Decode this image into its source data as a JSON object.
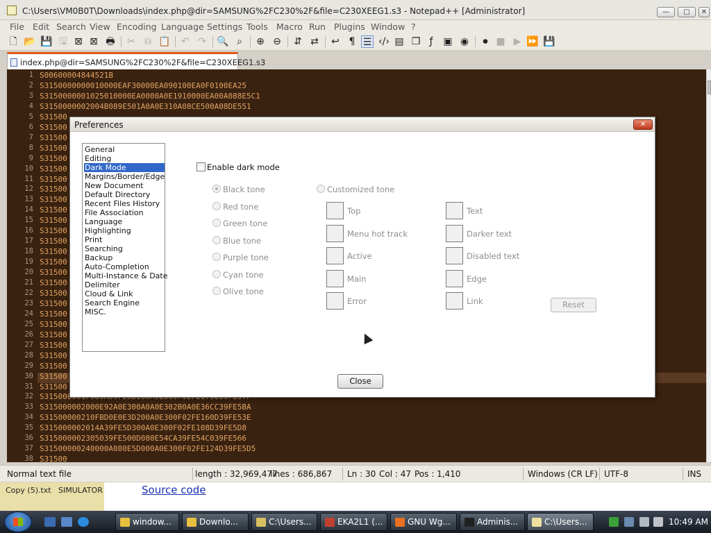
{
  "window": {
    "title": "C:\\Users\\VM0B0T\\Downloads\\index.php@dir=SAMSUNG%2FC230%2F&file=C230XEEG1.s3 - Notepad++ [Administrator]",
    "buttons": {
      "minimize": "—",
      "restore": "□",
      "close": "✕"
    }
  },
  "menu": [
    "File",
    "Edit",
    "Search",
    "View",
    "Encoding",
    "Language",
    "Settings",
    "Tools",
    "Macro",
    "Run",
    "Plugins",
    "Window",
    "?"
  ],
  "tab": {
    "label": "index.php@dir=SAMSUNG%2FC230%2F&file=C230XEEG1.s3"
  },
  "editor": {
    "line_numbers": [
      "1",
      "2",
      "3",
      "4",
      "5",
      "6",
      "7",
      "8",
      "9",
      "10",
      "11",
      "12",
      "13",
      "14",
      "15",
      "16",
      "17",
      "18",
      "19",
      "20",
      "21",
      "22",
      "23",
      "24",
      "25",
      "26",
      "27",
      "28",
      "29",
      "30",
      "31",
      "32",
      "33",
      "34",
      "35",
      "36",
      "37",
      "38"
    ],
    "lines": [
      "S00600004844521B",
      "S3150000000010000EAF30000EA090100EA0F0100EA25",
      "S3150000001025010000EA0000A0E1910000EA00A088E5C1",
      "S3150000002004B089E501A0A0E310A08CE500A08DE551",
      "S31500",
      "S31500",
      "S31500",
      "S31500",
      "S31500",
      "S31500",
      "S31500",
      "S31500",
      "S31500",
      "S31500",
      "S31500",
      "S31500",
      "S31500",
      "S31500",
      "S31500",
      "S31500",
      "S31500",
      "S31500",
      "S31500",
      "S31500",
      "S31500",
      "S31500",
      "S31500",
      "S31500",
      "S31500",
      "S31500",
      "S31500",
      "S315000001F080A39FE5D100A0E300F02FE178839FE57F",
      "S315000002000E92A0E300A0A0E302B0A0E36CC39FE5BA",
      "S31500000210FBD0E0E3D200A0E300F02FE160D39FE53E",
      "S315000002014A39FE5D300A0E300F02FE108D39FE5D8",
      "S315000002305039FE500D080E54CA39FE54C039FE566",
      "S31500000240000A080E5D000A0E300F02FE124D39FE5D5",
      "S31500"
    ]
  },
  "status": {
    "file_type": "Normal text file",
    "length": "length : 32,969,477",
    "lines": "lines : 686,867",
    "ln": "Ln : 30",
    "col": "Col : 47",
    "pos": "Pos : 1,410",
    "eol": "Windows (CR LF)",
    "encoding": "UTF-8",
    "mode": "INS"
  },
  "behind": {
    "item1": "Copy (5).txt",
    "item2": "SIMULATOR",
    "link": "Source code"
  },
  "dialog": {
    "title": "Preferences",
    "categories": [
      "General",
      "Editing",
      "Dark Mode",
      "Margins/Border/Edge",
      "New Document",
      "Default Directory",
      "Recent Files History",
      "File Association",
      "Language",
      "Highlighting",
      "Print",
      "Searching",
      "Backup",
      "Auto-Completion",
      "Multi-Instance & Date",
      "Delimiter",
      "Cloud & Link",
      "Search Engine",
      "MISC."
    ],
    "selected_category": "Dark Mode",
    "enable_dark_mode": "Enable dark mode",
    "tones": [
      "Black tone",
      "Red tone",
      "Green tone",
      "Blue tone",
      "Purple tone",
      "Cyan tone",
      "Olive tone"
    ],
    "customized_tone": "Customized tone",
    "colors_left": [
      "Top",
      "Menu hot track",
      "Active",
      "Main",
      "Error"
    ],
    "colors_right": [
      "Text",
      "Darker text",
      "Disabled text",
      "Edge",
      "Link"
    ],
    "reset": "Reset",
    "close": "Close"
  },
  "taskbar": {
    "items": [
      "window...",
      "Downlo...",
      "C:\\Users...",
      "EKA2L1 (...",
      "GNU Wg...",
      "Adminis...",
      "C:\\Users..."
    ],
    "clock": "10:49 AM"
  }
}
